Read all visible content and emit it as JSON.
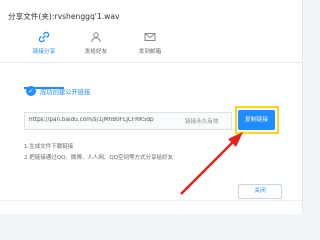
{
  "dialog": {
    "title": "分享文件(夹):rvshenggq'1.wav"
  },
  "tabs": [
    {
      "label": "链接分享",
      "icon": "link-icon",
      "active": true
    },
    {
      "label": "发给好友",
      "icon": "friend-icon",
      "active": false
    },
    {
      "label": "发到邮箱",
      "icon": "mail-icon",
      "active": false
    }
  ],
  "status": {
    "message": "成功创建公开链接",
    "icon": "check-circle-icon"
  },
  "share": {
    "url": "https://pan.baidu.com/s/1jMhB0FLJCFRK5dp",
    "validity": "链接永久有效",
    "copy_label": "复制链接"
  },
  "notes": [
    "1.生成文件下载链接",
    "2.把链接通过QQ、微博、人人网、QQ空间等方式分享给好友"
  ],
  "footer": {
    "close_label": "关闭"
  },
  "colors": {
    "accent": "#1f8cff",
    "highlight": "#ffd51a",
    "arrow": "#e32219"
  }
}
